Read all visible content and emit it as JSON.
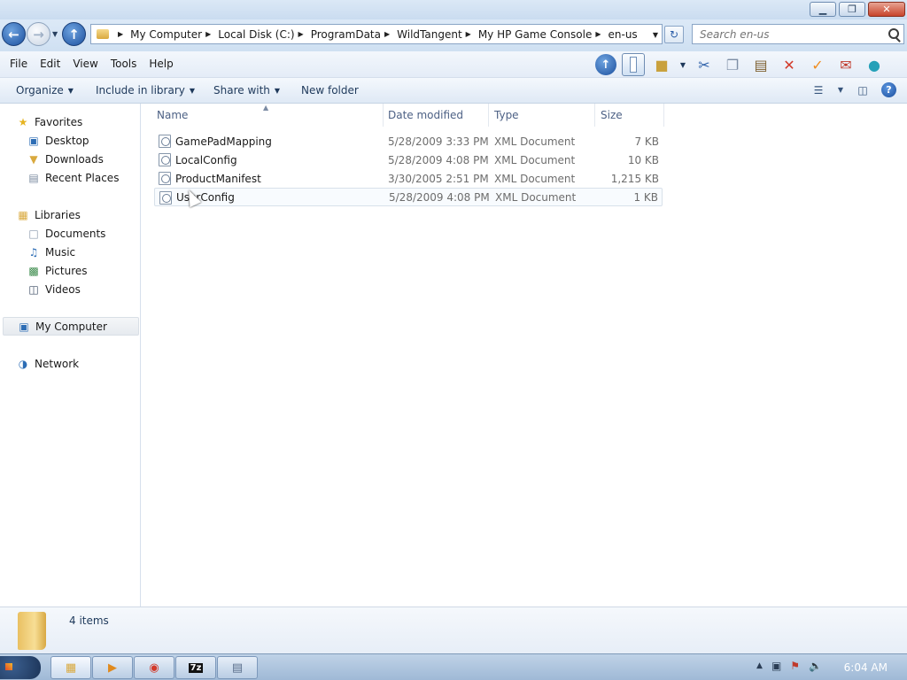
{
  "window": {
    "minimize_glyph": "▁",
    "maximize_glyph": "❐",
    "close_glyph": "✕"
  },
  "address": {
    "crumbs": [
      "My Computer",
      "Local Disk (C:)",
      "ProgramData",
      "WildTangent",
      "My HP Game Console",
      "en-us"
    ]
  },
  "search": {
    "placeholder": "Search en-us"
  },
  "menu": [
    "File",
    "Edit",
    "View",
    "Tools",
    "Help"
  ],
  "commands": {
    "organize": "Organize",
    "include_in_library": "Include in library",
    "share_with": "Share with",
    "new_folder": "New folder"
  },
  "nav": {
    "favorites": "Favorites",
    "desktop": "Desktop",
    "downloads": "Downloads",
    "recent_places": "Recent Places",
    "libraries": "Libraries",
    "documents": "Documents",
    "music": "Music",
    "pictures": "Pictures",
    "videos": "Videos",
    "my_computer": "My Computer",
    "network": "Network"
  },
  "columns": {
    "name": "Name",
    "date_modified": "Date modified",
    "type": "Type",
    "size": "Size"
  },
  "files": [
    {
      "name": "GamePadMapping",
      "date": "5/28/2009 3:33 PM",
      "type": "XML Document",
      "size": "7 KB"
    },
    {
      "name": "LocalConfig",
      "date": "5/28/2009 4:08 PM",
      "type": "XML Document",
      "size": "10 KB"
    },
    {
      "name": "ProductManifest",
      "date": "3/30/2005 2:51 PM",
      "type": "XML Document",
      "size": "1,215 KB"
    },
    {
      "name": "UserConfig",
      "date": "5/28/2009 4:08 PM",
      "type": "XML Document",
      "size": "1 KB"
    }
  ],
  "status": {
    "item_count": "4 items"
  },
  "taskbar": {
    "clock": "6:04 AM",
    "app_7z_label": "7z"
  },
  "colors": {
    "accent": "#1b4f9e",
    "chrome_bg": "#dce9f7",
    "text": "#1e395b"
  }
}
